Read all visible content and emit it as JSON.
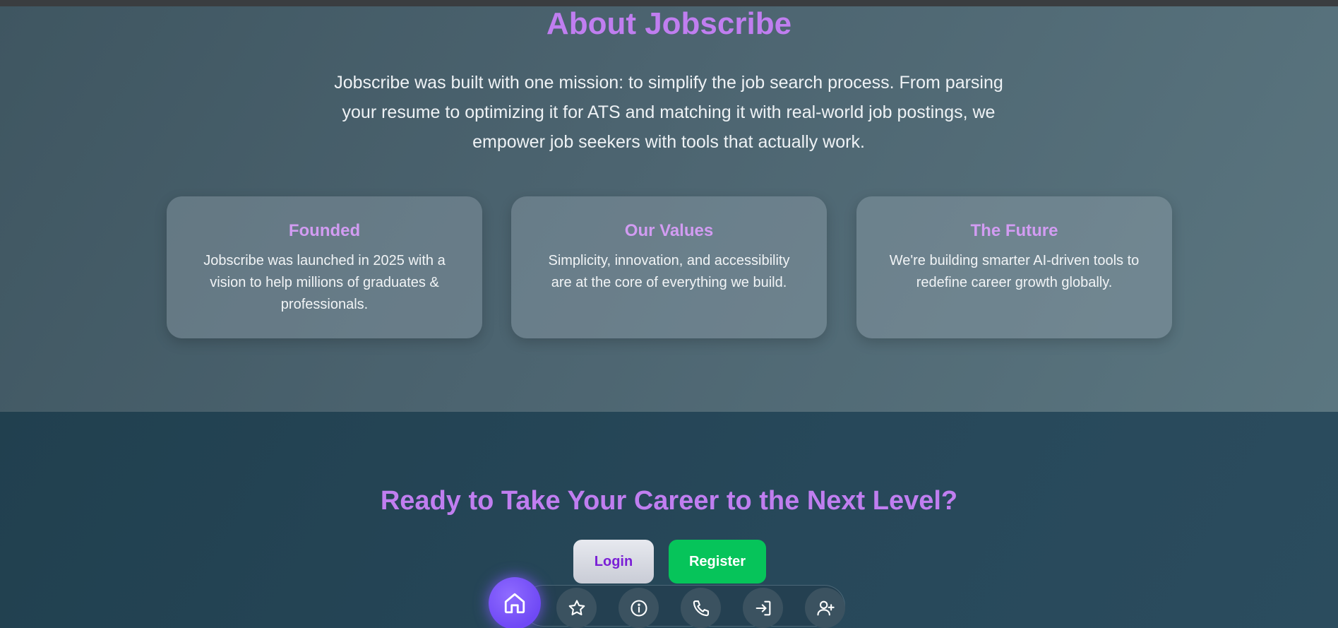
{
  "about": {
    "title": "About Jobscribe",
    "description": "Jobscribe was built with one mission: to simplify the job search process. From parsing your resume to optimizing it for ATS and matching it with real-world job postings, we empower job seekers with tools that actually work.",
    "cards": [
      {
        "title": "Founded",
        "text": "Jobscribe was launched in 2025 with a vision to help millions of graduates & professionals."
      },
      {
        "title": "Our Values",
        "text": "Simplicity, innovation, and accessibility are at the core of everything we build."
      },
      {
        "title": "The Future",
        "text": "We're building smarter AI-driven tools to redefine career growth globally."
      }
    ]
  },
  "cta": {
    "title": "Ready to Take Your Career to the Next Level?",
    "login_label": "Login",
    "register_label": "Register"
  },
  "dock": {
    "items": [
      {
        "icon": "home-icon"
      },
      {
        "icon": "star-icon"
      },
      {
        "icon": "info-icon"
      },
      {
        "icon": "phone-icon"
      },
      {
        "icon": "login-icon"
      },
      {
        "icon": "user-plus-icon"
      }
    ]
  },
  "colors": {
    "accent_purple": "#c07ef0",
    "register_green": "#06c45a",
    "dock_home": "#7b55f8"
  }
}
